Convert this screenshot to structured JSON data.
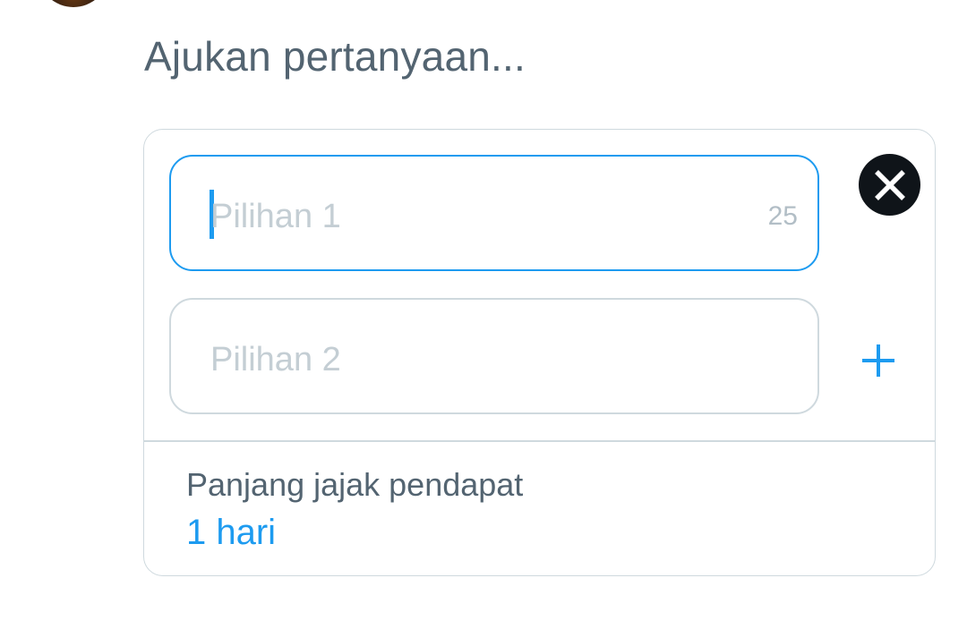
{
  "composer": {
    "question_placeholder": "Ajukan pertanyaan..."
  },
  "poll": {
    "choices": [
      {
        "placeholder": "Pilihan 1",
        "char_counter": "25"
      },
      {
        "placeholder": "Pilihan 2"
      }
    ],
    "length_label": "Panjang jajak pendapat",
    "length_value": "1 hari"
  },
  "icons": {
    "avatar": "user-avatar",
    "remove": "close-icon",
    "add": "plus-icon"
  },
  "colors": {
    "accent": "#1d9bf0",
    "secondary_text": "#536471",
    "placeholder": "#c4ced4",
    "border": "#cfd9de",
    "dark": "#0f1419"
  }
}
